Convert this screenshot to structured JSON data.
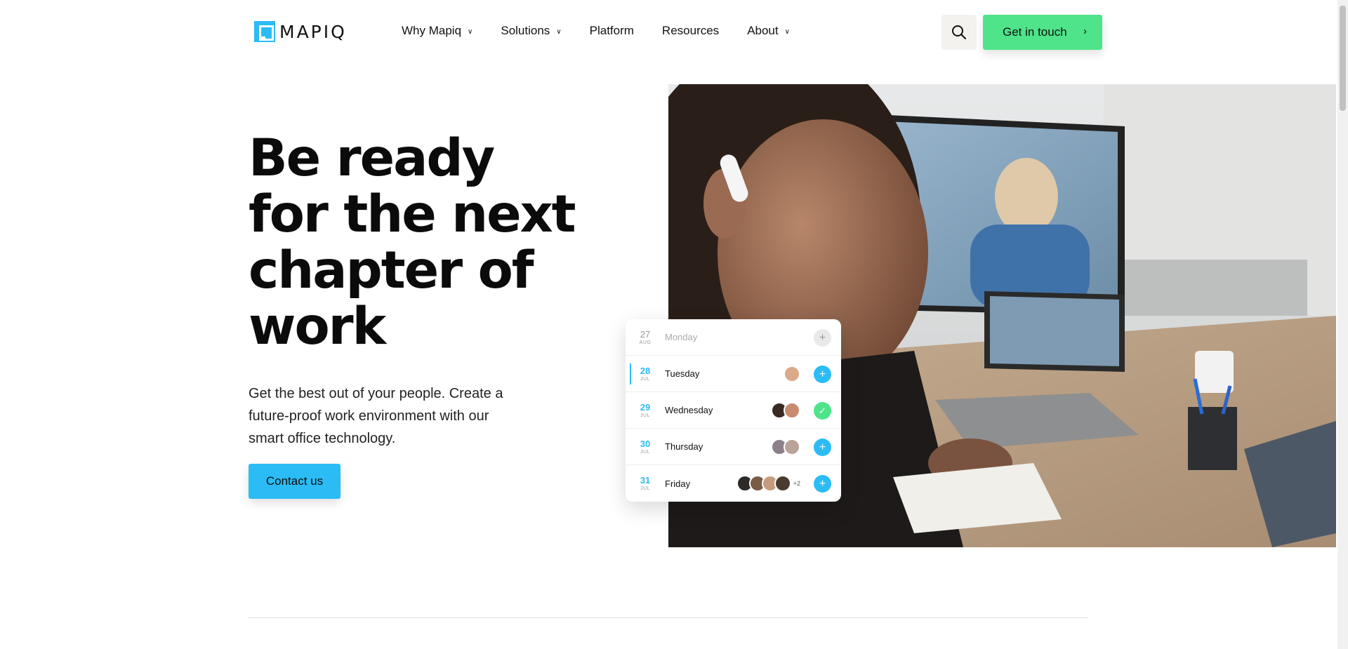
{
  "header": {
    "logo_text": "MAPIQ",
    "nav": [
      {
        "label": "Why Mapiq",
        "has_dropdown": true
      },
      {
        "label": "Solutions",
        "has_dropdown": true
      },
      {
        "label": "Platform",
        "has_dropdown": false
      },
      {
        "label": "Resources",
        "has_dropdown": false
      },
      {
        "label": "About",
        "has_dropdown": true
      }
    ],
    "search_icon": "search-icon",
    "cta_label": "Get in touch"
  },
  "hero": {
    "title": "Be ready for the next chapter of work",
    "subtitle": "Get the best out of your people. Create a future-proof work environment with our smart office technology.",
    "button_label": "Contact us"
  },
  "calendar": {
    "rows": [
      {
        "day": "27",
        "month": "AUG",
        "name": "Monday",
        "status": "add-muted",
        "avatars": 0,
        "more": ""
      },
      {
        "day": "28",
        "month": "JUL",
        "name": "Tuesday",
        "status": "plus",
        "avatars": 1,
        "more": ""
      },
      {
        "day": "29",
        "month": "JUL",
        "name": "Wednesday",
        "status": "check",
        "avatars": 2,
        "more": ""
      },
      {
        "day": "30",
        "month": "JUL",
        "name": "Thursday",
        "status": "plus",
        "avatars": 2,
        "more": ""
      },
      {
        "day": "31",
        "month": "JUL",
        "name": "Friday",
        "status": "plus",
        "avatars": 4,
        "more": "+2"
      }
    ]
  },
  "colors": {
    "brand_blue": "#2bbcf5",
    "cta_green": "#4fe38a",
    "text": "#111111"
  }
}
